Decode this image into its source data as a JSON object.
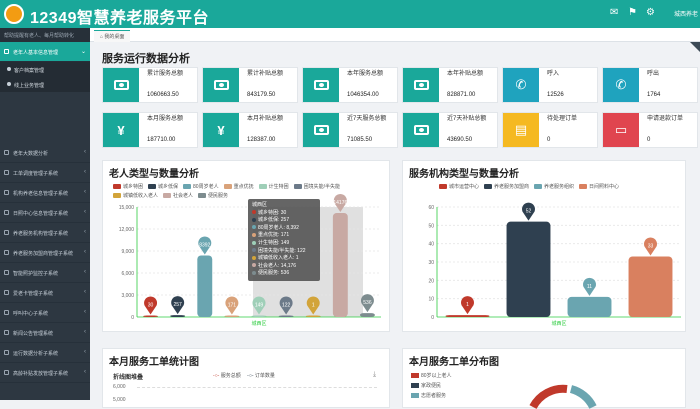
{
  "header": {
    "title": "12349智慧养老服务平台",
    "user": "城西养老"
  },
  "sidebar": {
    "user_line": "帮助提醒有老人、每月帮助转化",
    "items": [
      {
        "label": "老年人基本信息管理",
        "active": true,
        "arrow": "v"
      },
      {
        "label": "老年大数据分析",
        "arrow": "<"
      },
      {
        "label": "工单调度管理子系统",
        "arrow": "<"
      },
      {
        "label": "机构养老信息管理子系统",
        "arrow": "<"
      },
      {
        "label": "日照中心信息管理子系统",
        "arrow": "<"
      },
      {
        "label": "养老服务机构管理子系统",
        "arrow": "<"
      },
      {
        "label": "养老服务加盟商管理子系统",
        "arrow": "<"
      },
      {
        "label": "智能照护监控子系统",
        "arrow": "<"
      },
      {
        "label": "爱老卡管理子系统",
        "arrow": "<"
      },
      {
        "label": "呼叫中心子系统",
        "arrow": "<"
      },
      {
        "label": "新闻公告管理系统",
        "arrow": "<"
      },
      {
        "label": "运行数据分析子系统",
        "arrow": "<"
      },
      {
        "label": "高龄补贴发放管理子系统",
        "arrow": "<"
      }
    ],
    "subitems": [
      "客户档案管理",
      "线上业务管理"
    ]
  },
  "tabs": [
    {
      "label": "我的桌面"
    }
  ],
  "section_title": "服务运行数据分析",
  "stats": [
    {
      "label": "累计服务总额",
      "value": "1060663.50",
      "color": "#1aa89a",
      "icon": "bill"
    },
    {
      "label": "累计补贴总额",
      "value": "843179.50",
      "color": "#1aa89a",
      "icon": "bill"
    },
    {
      "label": "本年服务总额",
      "value": "1046354.00",
      "color": "#1aa89a",
      "icon": "bill"
    },
    {
      "label": "本年补贴总额",
      "value": "828871.00",
      "color": "#1aa89a",
      "icon": "bill"
    },
    {
      "label": "呼入",
      "value": "12526",
      "color": "#1fa3be",
      "icon": "phone"
    },
    {
      "label": "呼出",
      "value": "1764",
      "color": "#1fa3be",
      "icon": "phone"
    },
    {
      "label": "本月服务总额",
      "value": "187710.00",
      "color": "#1aa89a",
      "icon": "yen"
    },
    {
      "label": "本月补贴总额",
      "value": "128387.00",
      "color": "#1aa89a",
      "icon": "yen"
    },
    {
      "label": "近7天服务总额",
      "value": "71085.50",
      "color": "#1aa89a",
      "icon": "bill"
    },
    {
      "label": "近7天补贴总额",
      "value": "43690.50",
      "color": "#1aa89a",
      "icon": "bill"
    },
    {
      "label": "待处理订单",
      "value": "0",
      "color": "#f5b921",
      "icon": "doc"
    },
    {
      "label": "申请退款订单",
      "value": "0",
      "color": "#e0454f",
      "icon": "card"
    }
  ],
  "panels": {
    "elder": "老人类型与数量分析",
    "org": "服务机构类型与数量分析",
    "monthly": "本月服务工单统计图",
    "distribution": "本月服务工单分布图",
    "line_subtitle": "折线图堆叠"
  },
  "chart_data": [
    {
      "type": "bar",
      "title": "老人类型与数量分析",
      "categories": [
        "城西区"
      ],
      "series": [
        {
          "name": "城乡特困",
          "values": [
            30
          ],
          "color": "#c0392b"
        },
        {
          "name": "城乡低保",
          "values": [
            257
          ],
          "color": "#2f4050"
        },
        {
          "name": "80周岁老人",
          "values": [
            8392
          ],
          "color": "#6aa5b0"
        },
        {
          "name": "重点优抚",
          "values": [
            171
          ],
          "color": "#d9a27a"
        },
        {
          "name": "计生特困",
          "values": [
            149
          ],
          "color": "#9fcfb8"
        },
        {
          "name": "困境失能/半失能",
          "values": [
            122
          ],
          "color": "#6c7a89"
        },
        {
          "name": "城镇低收入老人",
          "values": [
            1
          ],
          "color": "#d2a43a"
        },
        {
          "name": "社会老人",
          "values": [
            14176
          ],
          "color": "#c8a9a3"
        },
        {
          "name": "便民服务",
          "values": [
            536
          ],
          "color": "#7d8c8f"
        }
      ],
      "yticks": [
        "0",
        "3,000",
        "6,000",
        "9,000",
        "12,000",
        "15,000"
      ],
      "ylim": [
        0,
        15000
      ],
      "tooltip": {
        "title": "城西区",
        "rows": [
          "城乡特困: 30",
          "城乡低保: 257",
          "80周岁老人: 8,392",
          "重点优抚: 171",
          "计生特困: 149",
          "困境失能/半失能: 122",
          "城镇低收入老人: 1",
          "社会老人: 14,176",
          "便民服务: 536"
        ]
      }
    },
    {
      "type": "bar",
      "title": "服务机构类型与数量分析",
      "categories": [
        "城西区"
      ],
      "series": [
        {
          "name": "城市运营中心",
          "values": [
            1
          ],
          "color": "#c0392b"
        },
        {
          "name": "养老服务加盟商",
          "values": [
            52
          ],
          "color": "#2f4050"
        },
        {
          "name": "养老服务组织",
          "values": [
            11
          ],
          "color": "#6aa5b0"
        },
        {
          "name": "日间照料中心",
          "values": [
            33
          ],
          "color": "#d9805f"
        }
      ],
      "yticks": [
        "0",
        "10",
        "20",
        "30",
        "40",
        "50",
        "60"
      ],
      "ylim": [
        0,
        60
      ]
    },
    {
      "type": "line",
      "title": "本月服务工单统计图",
      "subtitle": "折线图堆叠",
      "series": [
        {
          "name": "服务总额"
        },
        {
          "name": "订单数量"
        }
      ],
      "yticks": [
        "6,000",
        "5,000"
      ]
    },
    {
      "type": "pie",
      "title": "本月服务工单分布图",
      "series": [
        {
          "name": "80岁以上老人",
          "color": "#c0392b"
        },
        {
          "name": "家政便民",
          "color": "#2f4050"
        },
        {
          "name": "志愿者服务",
          "color": "#6aa5b0"
        }
      ]
    }
  ]
}
